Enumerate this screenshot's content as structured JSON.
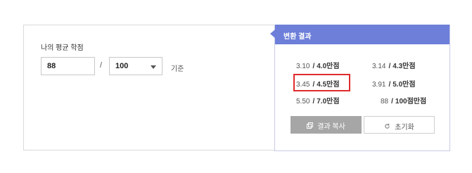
{
  "form": {
    "avg_label": "나의 평균 학점",
    "score_value": "88",
    "slash": "/",
    "scale_value": "100",
    "unit_label": "기준"
  },
  "result": {
    "header": "변환 결과",
    "items": [
      {
        "value": "3.10",
        "scale": "4.0만점"
      },
      {
        "value": "3.14",
        "scale": "4.3만점"
      },
      {
        "value": "3.45",
        "scale": "4.5만점",
        "highlighted": true
      },
      {
        "value": "3.91",
        "scale": "5.0만점"
      },
      {
        "value": "5.50",
        "scale": "7.0만점"
      },
      {
        "value": "88",
        "scale": "100점만점"
      }
    ],
    "item_slash": "/",
    "copy_button": "결과 복사",
    "reset_button": "초기화"
  },
  "icons": {
    "copy": "copy-icon",
    "reset": "refresh-icon",
    "dropdown": "chevron-down-icon"
  },
  "colors": {
    "header_bg": "#6d7fd9",
    "highlight": "#e02b2b",
    "copy_btn_bg": "#a6a6a6"
  }
}
